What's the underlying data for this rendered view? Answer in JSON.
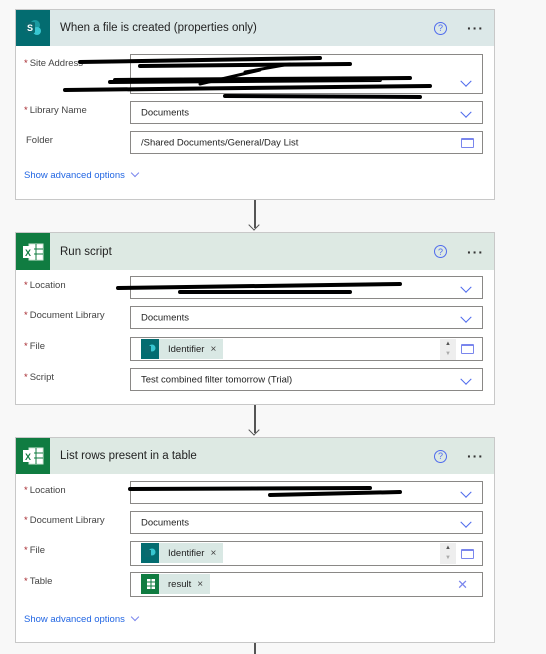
{
  "cards": [
    {
      "title": "When a file is created (properties only)",
      "icon": "sharepoint-icon",
      "header_color": "#dce8e8",
      "icon_bg": "#036c70",
      "fields": [
        {
          "label": "Site Address",
          "required": true,
          "value": ""
        },
        {
          "label": "Library Name",
          "required": true,
          "value": "Documents"
        },
        {
          "label": "Folder",
          "required": false,
          "value": "/Shared Documents/General/Day List"
        }
      ],
      "advanced": "Show advanced options"
    },
    {
      "title": "Run script",
      "icon": "excel-icon",
      "header_color": "#dde9e3",
      "icon_bg": "#107c41",
      "fields": [
        {
          "label": "Location",
          "required": true,
          "value": ""
        },
        {
          "label": "Document Library",
          "required": true,
          "value": "Documents"
        },
        {
          "label": "File",
          "required": true,
          "token": "Identifier"
        },
        {
          "label": "Script",
          "required": true,
          "value": "Test combined filter tomorrow (Trial)"
        }
      ]
    },
    {
      "title": "List rows present in a table",
      "icon": "excel-icon",
      "header_color": "#dde9e3",
      "icon_bg": "#107c41",
      "fields": [
        {
          "label": "Location",
          "required": true,
          "value": ""
        },
        {
          "label": "Document Library",
          "required": true,
          "value": "Documents"
        },
        {
          "label": "File",
          "required": true,
          "token": "Identifier"
        },
        {
          "label": "Table",
          "required": true,
          "token": "result"
        }
      ],
      "advanced": "Show advanced options"
    }
  ],
  "common": {
    "help": "?",
    "more": "···",
    "star": "*",
    "remove": "×",
    "clear": "✕",
    "spin_up": "▲",
    "spin_down": "▼"
  }
}
